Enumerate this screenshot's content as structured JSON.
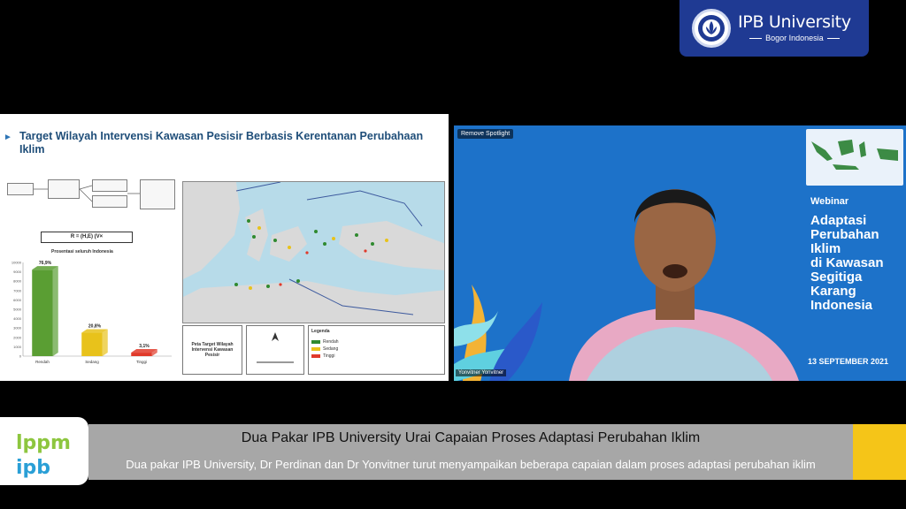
{
  "brand": {
    "name": "IPB University",
    "subtitle": "Bogor Indonesia",
    "badge_color": "#1f3a93"
  },
  "slide": {
    "title": "Target Wilayah Intervensi Kawasan Pesisir Berbasis Kerentanan Perubahaan Iklim",
    "chart_title": "Prosentasi seluruh Indonesia",
    "map_legend_title": "Peta Target Wilayah Intervensi Kawasan Pesisir",
    "legend_heading": "Legenda"
  },
  "chart_data": {
    "type": "bar",
    "title": "Prosentasi seluruh Indonesia",
    "categories": [
      "Rendah",
      "Sedang",
      "Tinggi"
    ],
    "series": [
      {
        "values": [
          76.9,
          20.8,
          3.1
        ]
      }
    ],
    "data_labels": [
      "76,9%",
      "20,8%",
      "3,1%"
    ],
    "colors": [
      "#5a9e33",
      "#e8c21b",
      "#e03a2a"
    ],
    "ylim": [
      0,
      10000
    ],
    "yticks": [
      0,
      1000,
      2000,
      3000,
      4000,
      5000,
      6000,
      7000,
      8000,
      9000,
      10000
    ]
  },
  "video": {
    "spotlight_label": "Remove Spotlight",
    "webinar_label": "Webinar",
    "webinar_title": "Adaptasi\nPerubahan\nIklim\ndi Kawasan\nSegitiga\nKarang\nIndonesia",
    "date": "13 SEPTEMBER 2021",
    "speaker_tag": "Yonvitner Yonvitner",
    "background_color": "#1d72c9"
  },
  "caption": {
    "title": "Dua Pakar IPB University Urai Capaian Proses Adaptasi Perubahan Iklim",
    "subtitle": "Dua pakar IPB University, Dr Perdinan dan Dr Yonvitner turut menyampaikan beberapa capaian dalam proses adaptasi perubahan iklim",
    "logo_text_top": "lppm",
    "logo_text_bottom": "ipb",
    "accent_color": "#f5c518"
  }
}
